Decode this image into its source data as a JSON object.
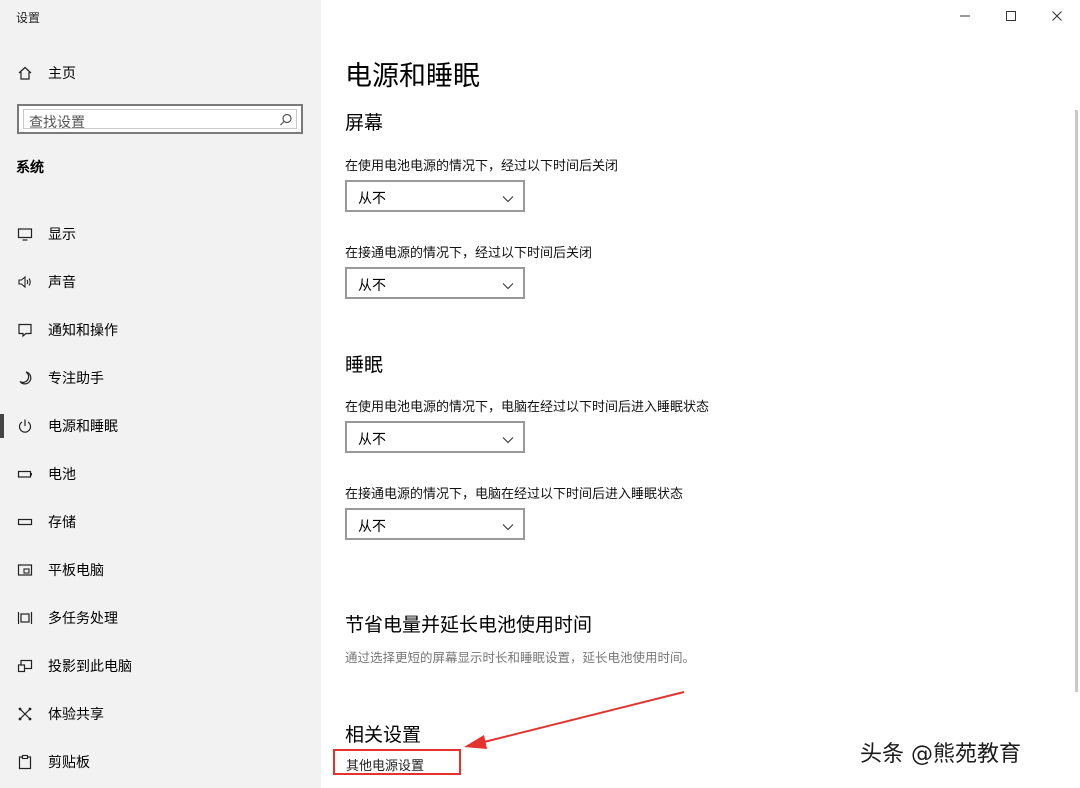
{
  "window": {
    "title": "设置"
  },
  "sidebar": {
    "home_label": "主页",
    "search_placeholder": "查找设置",
    "section_title": "系统",
    "items": [
      {
        "label": "显示",
        "icon": "monitor-icon",
        "active": false
      },
      {
        "label": "声音",
        "icon": "speaker-icon",
        "active": false
      },
      {
        "label": "通知和操作",
        "icon": "notification-icon",
        "active": false
      },
      {
        "label": "专注助手",
        "icon": "moon-icon",
        "active": false
      },
      {
        "label": "电源和睡眠",
        "icon": "power-icon",
        "active": true
      },
      {
        "label": "电池",
        "icon": "battery-icon",
        "active": false
      },
      {
        "label": "存储",
        "icon": "storage-icon",
        "active": false
      },
      {
        "label": "平板电脑",
        "icon": "tablet-icon",
        "active": false
      },
      {
        "label": "多任务处理",
        "icon": "multitask-icon",
        "active": false
      },
      {
        "label": "投影到此电脑",
        "icon": "project-icon",
        "active": false
      },
      {
        "label": "体验共享",
        "icon": "share-icon",
        "active": false
      },
      {
        "label": "剪贴板",
        "icon": "clipboard-icon",
        "active": false
      }
    ]
  },
  "main": {
    "page_title": "电源和睡眠",
    "screen": {
      "heading": "屏幕",
      "battery_label": "在使用电池电源的情况下，经过以下时间后关闭",
      "battery_value": "从不",
      "plugged_label": "在接通电源的情况下，经过以下时间后关闭",
      "plugged_value": "从不"
    },
    "sleep": {
      "heading": "睡眠",
      "battery_label": "在使用电池电源的情况下，电脑在经过以下时间后进入睡眠状态",
      "battery_value": "从不",
      "plugged_label": "在接通电源的情况下，电脑在经过以下时间后进入睡眠状态",
      "plugged_value": "从不"
    },
    "save": {
      "heading": "节省电量并延长电池使用时间",
      "description": "通过选择更短的屏幕显示时长和睡眠设置，延长电池使用时间。"
    },
    "related": {
      "heading": "相关设置",
      "link": "其他电源设置"
    }
  },
  "watermark": "头条 @熊苑教育",
  "colors": {
    "annotation_red": "#e5322d",
    "sidebar_bg": "#f2f2f2"
  }
}
